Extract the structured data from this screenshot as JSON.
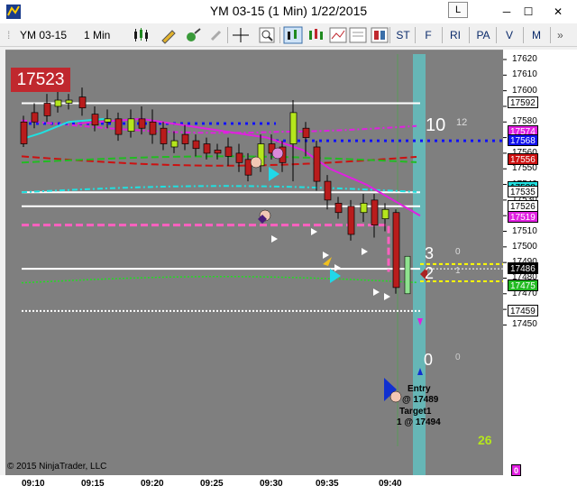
{
  "window": {
    "title": "YM 03-15 (1 Min)  1/22/2015",
    "l_button": "L",
    "min_glyph": "─",
    "max_glyph": "☐",
    "close_glyph": "✕"
  },
  "toolbar": {
    "instrument": "YM 03-15",
    "interval": "1 Min",
    "buttons": [
      "ST",
      "F",
      "RI",
      "PA",
      "V",
      "M"
    ]
  },
  "chart": {
    "last_price_box": "17523",
    "copyright": "© 2015 NinjaTrader, LLC",
    "line_labels": [
      {
        "big": "10",
        "small": "12"
      },
      {
        "big": "3",
        "small": "0"
      },
      {
        "big": "2",
        "small": "1"
      },
      {
        "big": "0",
        "small": "0"
      }
    ],
    "entry_label": "Entry",
    "entry_price": "@ 17489",
    "target_label": "Target1",
    "target_price": "1 @ 17494",
    "bar_count": "26",
    "colors": {
      "background": "#7f7f7f",
      "up_candle": "#b5e61d",
      "down_candle": "#b91c1c",
      "magenta": "#e020e0",
      "blue_dotted": "#1010ff",
      "red_dash": "#cc1111",
      "green_dash": "#22bb22",
      "cyan": "#20e0e0"
    }
  },
  "y_axis": {
    "ticks": [
      "17620",
      "17610",
      "17600",
      "17590",
      "17580",
      "17570",
      "17560",
      "17550",
      "17540",
      "17530",
      "17520",
      "17510",
      "17500",
      "17490",
      "17480",
      "17470",
      "17460",
      "17450"
    ],
    "tags": [
      {
        "text": "17592",
        "bg": "#ffffff",
        "fg": "#000000"
      },
      {
        "text": "17574",
        "bg": "#e020e0",
        "fg": "#ffffff"
      },
      {
        "text": "17568",
        "bg": "#1010ee",
        "fg": "#ffffff"
      },
      {
        "text": "17556",
        "bg": "#cc1111",
        "fg": "#ffffff"
      },
      {
        "text": "17538",
        "bg": "#20e0e0",
        "fg": "#000000"
      },
      {
        "text": "17535",
        "bg": "#ffffff",
        "fg": "#000000"
      },
      {
        "text": "17526",
        "bg": "#ffffff",
        "fg": "#000000"
      },
      {
        "text": "17519",
        "bg": "#e020e0",
        "fg": "#ffffff"
      },
      {
        "text": "17486",
        "bg": "#000000",
        "fg": "#ffffff"
      },
      {
        "text": "17475",
        "bg": "#22bb22",
        "fg": "#ffffff"
      },
      {
        "text": "17459",
        "bg": "#ffffff",
        "fg": "#000000"
      }
    ],
    "bottom_tag": "0"
  },
  "x_axis": {
    "ticks": [
      "09:10",
      "09:15",
      "09:20",
      "09:25",
      "09:30",
      "09:35",
      "09:40"
    ]
  }
}
